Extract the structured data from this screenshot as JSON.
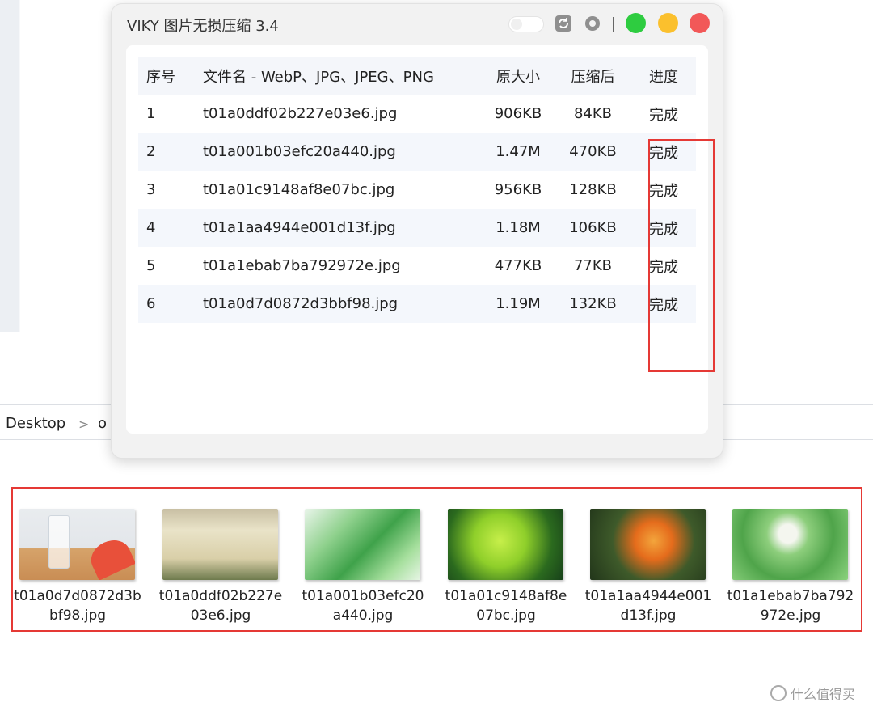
{
  "app": {
    "title": "VIKY 图片无损压缩 3.4",
    "icons": [
      "toggle-switch",
      "refresh-icon",
      "settings-icon"
    ],
    "window_controls": {
      "green": "#2ecc40",
      "yellow": "#fbc02d",
      "red": "#f25858"
    }
  },
  "table": {
    "headers": {
      "index": "序号",
      "name": "文件名 - WebP、JPG、JPEG、PNG",
      "original": "原大小",
      "compressed": "压缩后",
      "progress": "进度"
    },
    "rows": [
      {
        "index": "1",
        "name": "t01a0ddf02b227e03e6.jpg",
        "original": "906KB",
        "compressed": "84KB",
        "progress": "完成"
      },
      {
        "index": "2",
        "name": "t01a001b03efc20a440.jpg",
        "original": "1.47M",
        "compressed": "470KB",
        "progress": "完成"
      },
      {
        "index": "3",
        "name": "t01a01c9148af8e07bc.jpg",
        "original": "956KB",
        "compressed": "128KB",
        "progress": "完成"
      },
      {
        "index": "4",
        "name": "t01a1aa4944e001d13f.jpg",
        "original": "1.18M",
        "compressed": "106KB",
        "progress": "完成"
      },
      {
        "index": "5",
        "name": "t01a1ebab7ba792972e.jpg",
        "original": "477KB",
        "compressed": "77KB",
        "progress": "完成"
      },
      {
        "index": "6",
        "name": "t01a0d7d0872d3bbf98.jpg",
        "original": "1.19M",
        "compressed": "132KB",
        "progress": "完成"
      }
    ]
  },
  "explorer": {
    "breadcrumb": {
      "root": "Desktop",
      "separator": ">",
      "next": "o"
    },
    "files": [
      {
        "name": "t01a0d7d0872d3bbf98.jpg"
      },
      {
        "name": "t01a0ddf02b227e03e6.jpg"
      },
      {
        "name": "t01a001b03efc20a440.jpg"
      },
      {
        "name": "t01a01c9148af8e07bc.jpg"
      },
      {
        "name": "t01a1aa4944e001d13f.jpg"
      },
      {
        "name": "t01a1ebab7ba792972e.jpg"
      }
    ]
  },
  "watermark": {
    "text": "什么值得买"
  },
  "colors": {
    "highlight": "#e53935",
    "accent_row": "#f4f7fc"
  }
}
